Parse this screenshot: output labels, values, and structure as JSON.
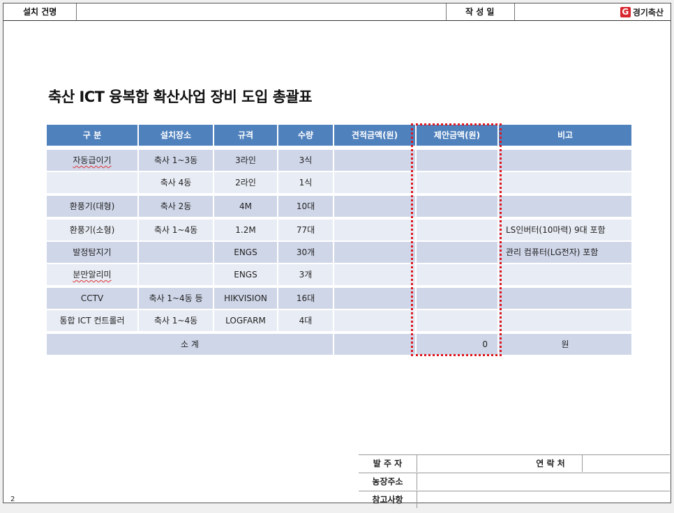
{
  "header": {
    "label_project": "설치 건명",
    "label_date": "작 성 일",
    "company": "경기축산",
    "logo_letter": "G"
  },
  "document": {
    "title": "축산 ICT 융복합 확산사업 장비 도입 총괄표"
  },
  "table": {
    "columns": [
      "구 분",
      "설치장소",
      "규격",
      "수량",
      "견적금액(원)",
      "제안금액(원)",
      "비고"
    ],
    "rows": [
      [
        "자동급이기",
        "축사 1~3동",
        "3라인",
        "3식",
        "",
        "",
        ""
      ],
      [
        "",
        "축사 4동",
        "2라인",
        "1식",
        "",
        "",
        ""
      ],
      [
        "환풍기(대형)",
        "축사 2동",
        "4M",
        "10대",
        "",
        "",
        ""
      ],
      [
        "환풍기(소형)",
        "축사 1~4동",
        "1.2M",
        "77대",
        "",
        "",
        "LS인버터(10마력) 9대 포함"
      ],
      [
        "발정탐지기",
        "",
        "ENGS",
        "30개",
        "",
        "",
        "관리 컴퓨터(LG전자) 포함"
      ],
      [
        "분만알리미",
        "",
        "ENGS",
        "3개",
        "",
        "",
        ""
      ],
      [
        "CCTV",
        "축사 1~4동 등",
        "HIKVISION",
        "16대",
        "",
        "",
        ""
      ],
      [
        "통합 ICT 컨트롤러",
        "축사 1~4동",
        "LOGFARM",
        "4대",
        "",
        "",
        ""
      ]
    ],
    "subtotal": {
      "label": "소 계",
      "estimate": "",
      "proposal": "0",
      "unit": "원"
    }
  },
  "footer": {
    "client": "발 주 자",
    "contact": "연 락 처",
    "farm_address": "농장주소",
    "notes": "참고사항"
  },
  "page_number": "2"
}
